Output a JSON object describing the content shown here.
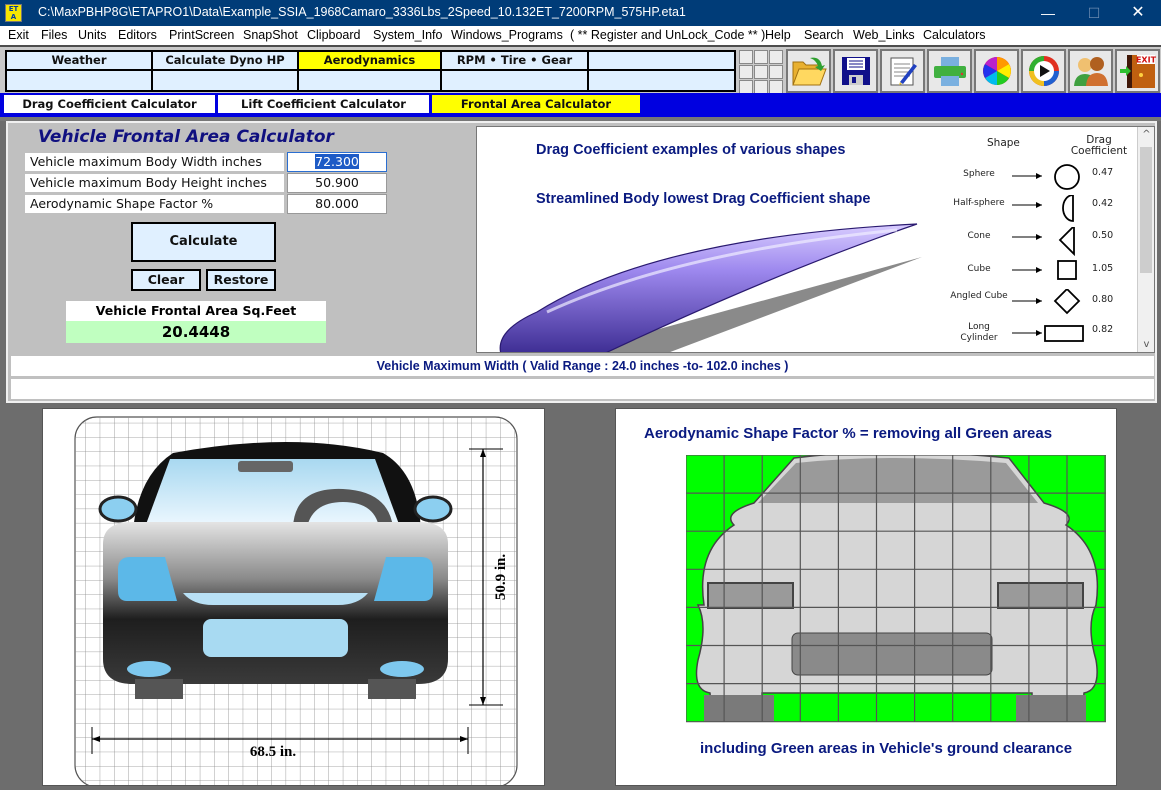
{
  "window": {
    "app_icon_text": "ET A",
    "title": "C:\\MaxPBHP8G\\ETAPRO1\\Data\\Example_SSIA_1968Camaro_3336Lbs_2Speed_10.132ET_7200RPM_575HP.eta1",
    "minimize": "—",
    "maximize": "☐",
    "close": "✕"
  },
  "menu": [
    "Exit",
    "Files",
    "Units",
    "Editors",
    "PrintScreen",
    "SnapShot",
    "Clipboard",
    "System_Info",
    "Windows_Programs",
    "( ** Register and UnLock_Code ** )",
    "Help",
    "Search",
    "Web_Links",
    "Calculators"
  ],
  "top_tabs": [
    {
      "label": "Weather",
      "active": false
    },
    {
      "label": "Calculate Dyno HP",
      "active": false
    },
    {
      "label": "Aerodynamics",
      "active": true
    },
    {
      "label": "RPM  •  Tire  •  Gear",
      "active": false
    },
    {
      "label": "",
      "active": false
    }
  ],
  "toolbar_icons": [
    "open-folder-icon",
    "save-disk-icon",
    "notepad-icon",
    "printer-icon",
    "color-wheel-icon",
    "media-play-icon",
    "users-icon",
    "exit-door-icon"
  ],
  "exit_icon_text": "EXIT",
  "sub_tabs": [
    {
      "label": "Drag Coefficient Calculator",
      "active": false
    },
    {
      "label": "Lift Coefficient Calculator",
      "active": false
    },
    {
      "label": "Frontal Area Calculator",
      "active": true
    }
  ],
  "calculator": {
    "title": "Vehicle  Frontal  Area  Calculator",
    "fields": [
      {
        "label": "Vehicle maximum Body Width  inches",
        "value": "72.300",
        "selected": true
      },
      {
        "label": "Vehicle maximum Body Height  inches",
        "value": "50.900",
        "selected": false
      },
      {
        "label": "Aerodynamic Shape Factor %",
        "value": "80.000",
        "selected": false
      }
    ],
    "calculate_label": "Calculate",
    "clear_label": "Clear",
    "restore_label": "Restore",
    "result_label": "Vehicle  Frontal  Area  Sq.Feet",
    "result_value": "20.4448"
  },
  "drag_panel": {
    "heading1": "Drag Coefficient examples of various shapes",
    "heading2": "Streamlined Body lowest Drag Coefficient shape",
    "col_shape": "Shape",
    "col_drag": "Drag Coefficient",
    "shapes": [
      {
        "name": "Sphere",
        "cd": "0.47"
      },
      {
        "name": "Half-sphere",
        "cd": "0.42"
      },
      {
        "name": "Cone",
        "cd": "0.50"
      },
      {
        "name": "Cube",
        "cd": "1.05"
      },
      {
        "name": "Angled Cube",
        "cd": "0.80"
      },
      {
        "name": "Long Cylinder",
        "cd": "0.82"
      }
    ]
  },
  "hint": "Vehicle Maximum Width     ( Valid Range :  24.0 inches  -to-  102.0 inches )",
  "left_picture": {
    "width_label": "68.5 in.",
    "height_label": "50.9 in."
  },
  "right_picture": {
    "top_text": "Aerodynamic Shape Factor  %   =   removing all Green areas",
    "bottom_text": "including Green areas in Vehicle's ground clearance"
  },
  "colors": {
    "title_bar": "#003c78",
    "active_tab": "#ffff00",
    "subtab_bar": "#0000e0",
    "text_blue": "#0a1a80",
    "result_bg": "#c0ffc0",
    "green_area": "#00ff00"
  }
}
